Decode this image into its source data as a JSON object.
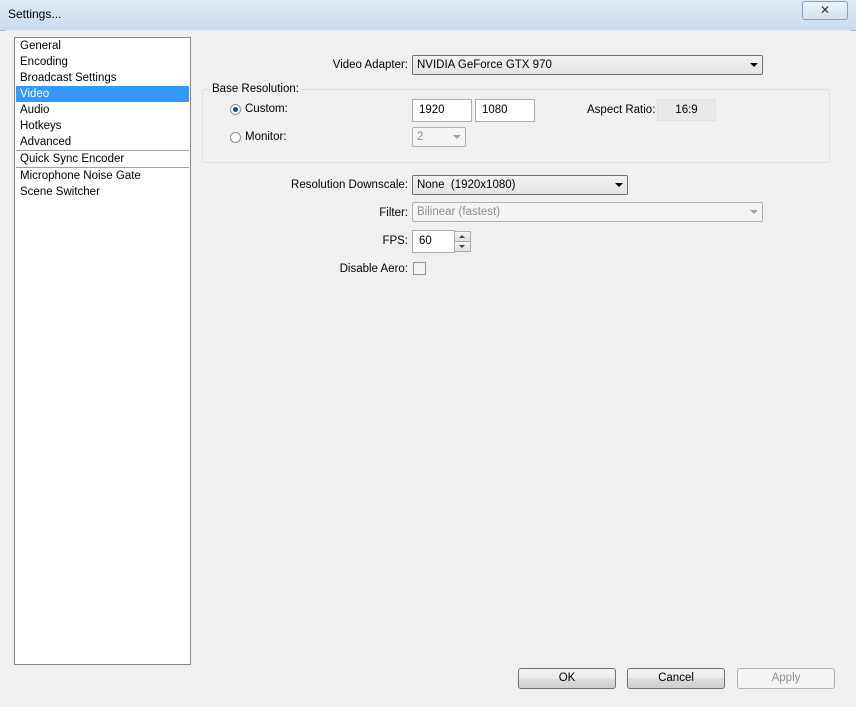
{
  "window": {
    "title": "Settings...",
    "close_label": "✕"
  },
  "sidebar": {
    "items": [
      {
        "label": "General"
      },
      {
        "label": "Encoding"
      },
      {
        "label": "Broadcast Settings"
      },
      {
        "label": "Video",
        "selected": true
      },
      {
        "label": "Audio"
      },
      {
        "label": "Hotkeys"
      },
      {
        "label": "Advanced"
      },
      {
        "label": "Quick Sync Encoder"
      },
      {
        "label": "Microphone Noise Gate"
      },
      {
        "label": "Scene Switcher"
      }
    ]
  },
  "video": {
    "adapter_label": "Video Adapter:",
    "adapter_value": "NVIDIA GeForce GTX 970",
    "base_resolution_label": "Base Resolution:",
    "custom_label": "Custom:",
    "custom_checked": true,
    "width": "1920",
    "height": "1080",
    "aspect_label": "Aspect Ratio:",
    "aspect_value": "16:9",
    "monitor_label": "Monitor:",
    "monitor_checked": false,
    "monitor_value": "2",
    "downscale_label": "Resolution Downscale:",
    "downscale_value": "None  (1920x1080)",
    "filter_label": "Filter:",
    "filter_value": "Bilinear (fastest)",
    "fps_label": "FPS:",
    "fps_value": "60",
    "disable_aero_label": "Disable Aero:",
    "disable_aero_checked": false
  },
  "buttons": {
    "ok": "OK",
    "cancel": "Cancel",
    "apply": "Apply"
  }
}
